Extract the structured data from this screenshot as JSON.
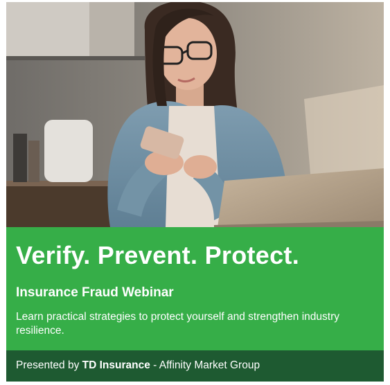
{
  "banner": {
    "headline": "Verify. Prevent. Protect.",
    "subheadline": "Insurance Fraud Webinar",
    "description": "Learn practical strategies to protect yourself and strengthen industry resilience.",
    "footer": {
      "presented_by": "Presented by",
      "brand": "TD Insurance",
      "separator": " - ",
      "group": "Affinity Market Group"
    }
  },
  "colors": {
    "band": "#36ae48",
    "footer": "#1e5a31",
    "text": "#ffffff"
  }
}
